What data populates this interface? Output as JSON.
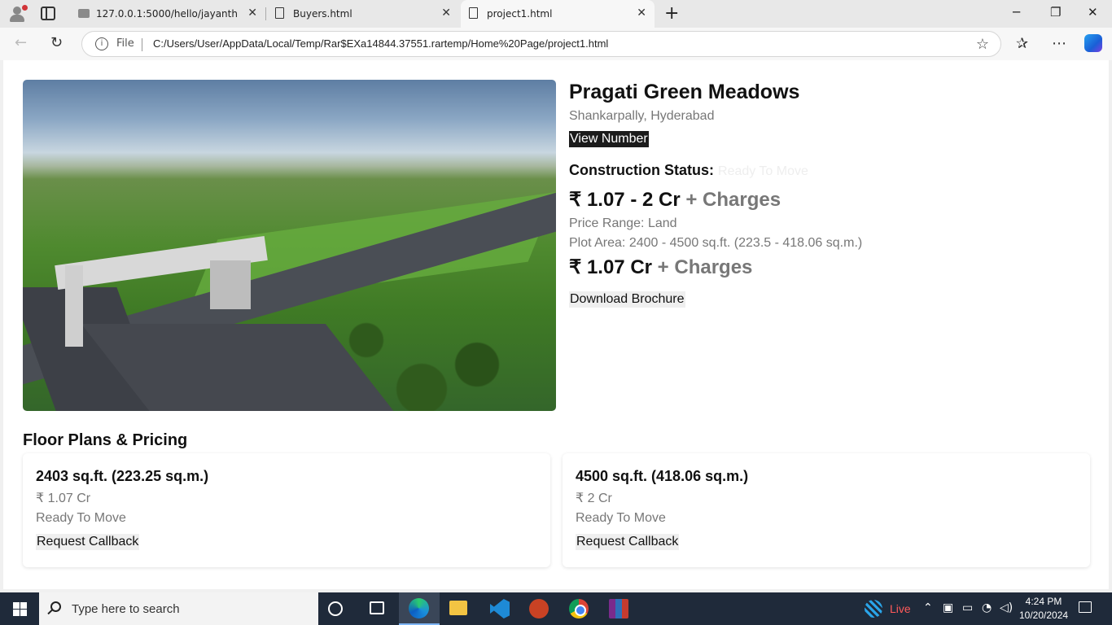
{
  "browser": {
    "tabs": [
      {
        "title": "127.0.0.1:5000/hello/jayanth",
        "active": false
      },
      {
        "title": "Buyers.html",
        "active": false
      },
      {
        "title": "project1.html",
        "active": true
      }
    ],
    "file_label": "File",
    "url": "C:/Users/User/AppData/Local/Temp/Rar$EXa14844.37551.rartemp/Home%20Page/project1.html"
  },
  "project": {
    "name": "Pragati Green Meadows",
    "location": "Shankarpally, Hyderabad",
    "view_number_label": "View Number",
    "status_label": "Construction Status:",
    "status_value": "Ready To Move",
    "price_range_text": "₹ 1.07 - 2 Cr",
    "charges_text": "+ Charges",
    "price_range_label": "Price Range: Land",
    "plot_area": "Plot Area: 2400 - 4500 sq.ft. (223.5 - 418.06 sq.m.)",
    "base_price": "₹ 1.07 Cr",
    "base_charges": "+ Charges",
    "brochure_label": "Download Brochure"
  },
  "floor_plans": {
    "title": "Floor Plans & Pricing",
    "cards": [
      {
        "size": "2403 sq.ft. (223.25 sq.m.)",
        "price": "₹ 1.07 Cr",
        "status": "Ready To Move",
        "callback": "Request Callback"
      },
      {
        "size": "4500 sq.ft. (418.06 sq.m.)",
        "price": "₹ 2 Cr",
        "status": "Ready To Move",
        "callback": "Request Callback"
      }
    ]
  },
  "taskbar": {
    "search_placeholder": "Type here to search",
    "live_label": "Live",
    "time": "4:24 PM",
    "date": "10/20/2024"
  }
}
